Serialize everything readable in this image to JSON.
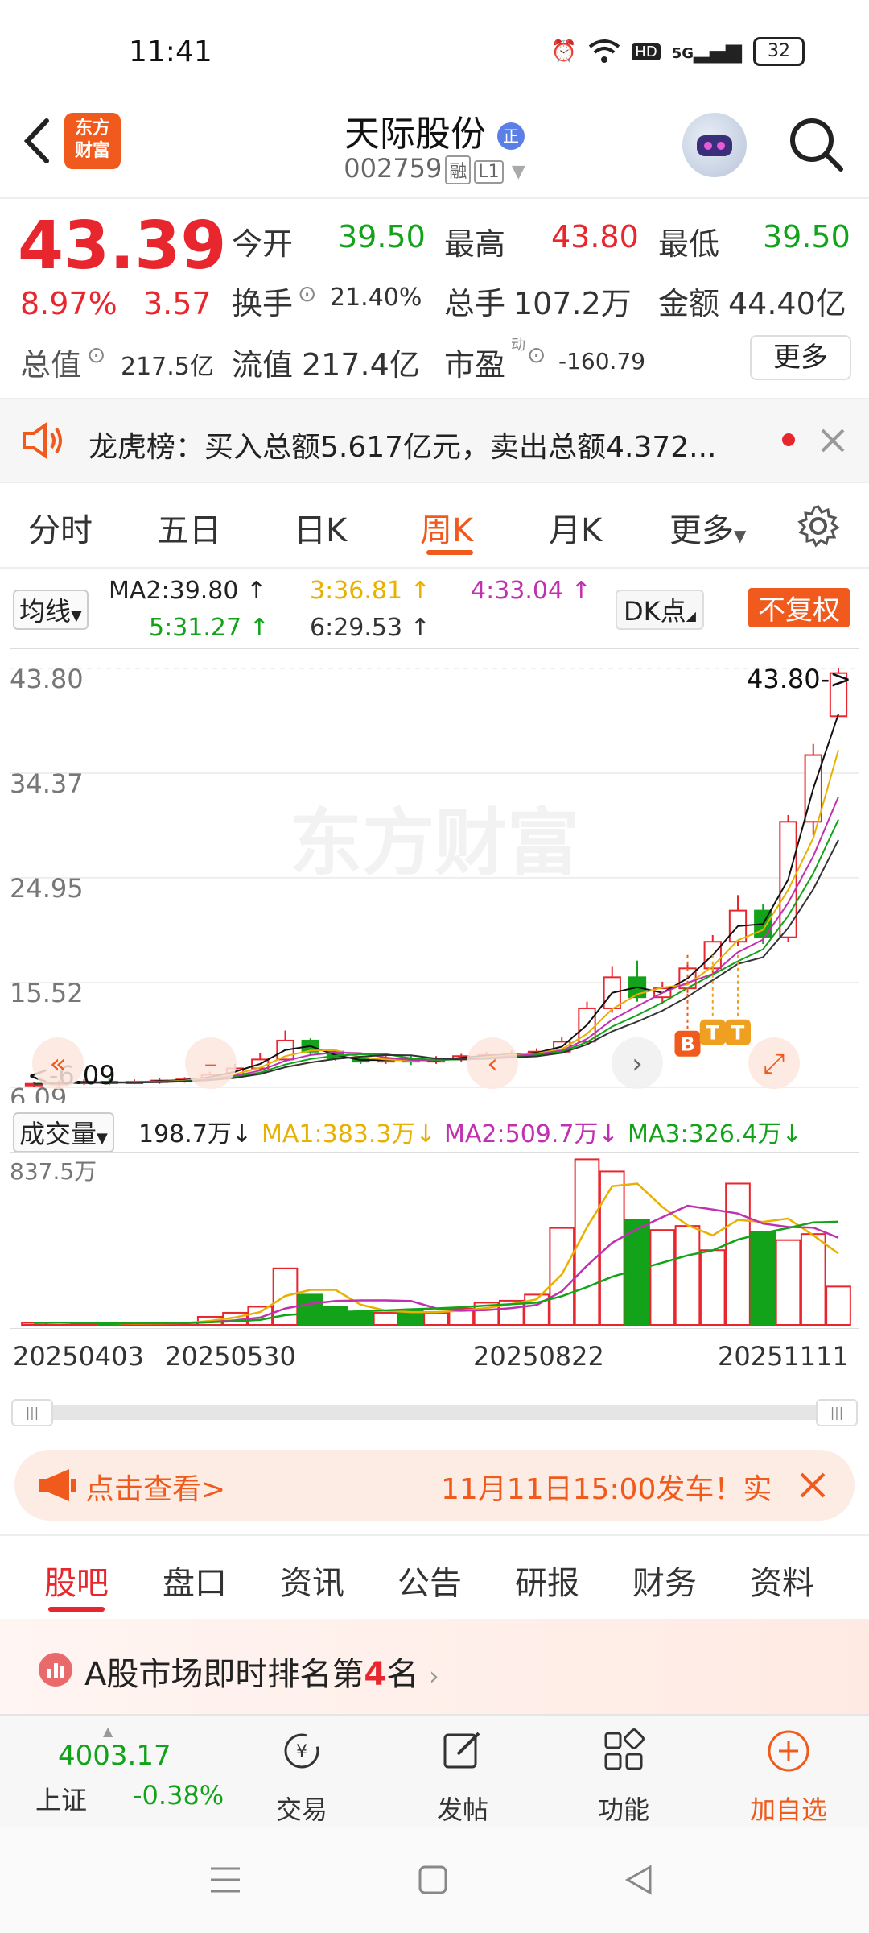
{
  "status_bar": {
    "time": "11:41",
    "battery": "32",
    "network": "5G",
    "hd": "HD"
  },
  "header": {
    "logo_line1": "东方",
    "logo_line2": "财富",
    "stock_name": "天际股份",
    "stock_code": "002759",
    "tag_margin": "融",
    "tag_level": "L1"
  },
  "quote": {
    "price": "43.39",
    "change_pct": "8.97%",
    "change": "3.57",
    "open_label": "今开",
    "open": "39.50",
    "high_label": "最高",
    "high": "43.80",
    "low_label": "最低",
    "low": "39.50",
    "turnover_label": "换手",
    "turnover": "21.40%",
    "volume_label": "总手",
    "volume": "107.2万",
    "amount_label": "金额",
    "amount": "44.40亿",
    "mktcap_label": "总值",
    "mktcap": "217.5亿",
    "float_label": "流值",
    "float": "217.4亿",
    "pe_label": "市盈",
    "pe_sup": "动",
    "pe": "-160.79",
    "more": "更多"
  },
  "news": {
    "text": "龙虎榜：买入总额5.617亿元，卖出总额4.372..."
  },
  "tabs": [
    "分时",
    "五日",
    "日K",
    "周K",
    "月K",
    "更多"
  ],
  "ma_row": {
    "ma_button": "均线",
    "ma2": "MA2:39.80",
    "ma3": "3:36.81",
    "ma4": "4:33.04",
    "ma5": "5:31.27",
    "ma6": "6:29.53",
    "dk_button": "DK点",
    "fq_button": "不复权"
  },
  "chart_data": {
    "type": "candlestick",
    "y_ticks": [
      "43.80",
      "34.37",
      "24.95",
      "15.52",
      "6.09"
    ],
    "ylim": [
      6.09,
      43.8
    ],
    "high_marker": "43.80->",
    "low_marker": "<-6.09",
    "watermark": "东方财富",
    "bt_markers": [
      "B",
      "T",
      "T"
    ],
    "candles": [
      {
        "o": 6.3,
        "c": 6.4,
        "h": 6.6,
        "l": 6.1
      },
      {
        "o": 6.4,
        "c": 6.5,
        "h": 6.7,
        "l": 6.2
      },
      {
        "o": 6.5,
        "c": 6.6,
        "h": 6.8,
        "l": 6.3
      },
      {
        "o": 6.6,
        "c": 6.5,
        "h": 6.9,
        "l": 6.3
      },
      {
        "o": 6.5,
        "c": 6.6,
        "h": 6.8,
        "l": 6.4
      },
      {
        "o": 6.6,
        "c": 6.7,
        "h": 6.9,
        "l": 6.4
      },
      {
        "o": 6.7,
        "c": 6.8,
        "h": 7.0,
        "l": 6.5
      },
      {
        "o": 6.8,
        "c": 7.2,
        "h": 7.5,
        "l": 6.7
      },
      {
        "o": 7.2,
        "c": 7.8,
        "h": 8.2,
        "l": 7.0
      },
      {
        "o": 7.8,
        "c": 8.6,
        "h": 9.2,
        "l": 7.6
      },
      {
        "o": 8.6,
        "c": 10.3,
        "h": 11.2,
        "l": 8.4
      },
      {
        "o": 10.3,
        "c": 9.3,
        "h": 10.5,
        "l": 9.0
      },
      {
        "o": 9.3,
        "c": 8.7,
        "h": 9.5,
        "l": 8.5
      },
      {
        "o": 8.7,
        "c": 8.4,
        "h": 8.9,
        "l": 8.2
      },
      {
        "o": 8.4,
        "c": 8.7,
        "h": 9.0,
        "l": 8.2
      },
      {
        "o": 8.7,
        "c": 8.4,
        "h": 8.9,
        "l": 8.1
      },
      {
        "o": 8.4,
        "c": 8.6,
        "h": 8.9,
        "l": 8.2
      },
      {
        "o": 8.6,
        "c": 8.9,
        "h": 9.1,
        "l": 8.4
      },
      {
        "o": 8.9,
        "c": 9.0,
        "h": 9.3,
        "l": 8.7
      },
      {
        "o": 9.0,
        "c": 9.1,
        "h": 9.4,
        "l": 8.8
      },
      {
        "o": 9.1,
        "c": 9.3,
        "h": 9.6,
        "l": 8.9
      },
      {
        "o": 9.3,
        "c": 10.2,
        "h": 10.6,
        "l": 9.1
      },
      {
        "o": 10.2,
        "c": 13.2,
        "h": 13.8,
        "l": 10.0
      },
      {
        "o": 13.2,
        "c": 16.0,
        "h": 17.0,
        "l": 12.8
      },
      {
        "o": 16.0,
        "c": 14.2,
        "h": 17.5,
        "l": 13.8
      },
      {
        "o": 14.2,
        "c": 15.0,
        "h": 15.6,
        "l": 13.6
      },
      {
        "o": 15.0,
        "c": 16.8,
        "h": 17.2,
        "l": 14.6
      },
      {
        "o": 16.8,
        "c": 19.2,
        "h": 19.8,
        "l": 16.4
      },
      {
        "o": 19.2,
        "c": 22.0,
        "h": 23.4,
        "l": 18.8
      },
      {
        "o": 22.0,
        "c": 19.6,
        "h": 22.6,
        "l": 19.0
      },
      {
        "o": 19.6,
        "c": 30.0,
        "h": 30.6,
        "l": 19.2
      },
      {
        "o": 30.0,
        "c": 36.0,
        "h": 37.0,
        "l": 28.8
      },
      {
        "o": 39.5,
        "c": 43.39,
        "h": 43.8,
        "l": 39.5
      }
    ]
  },
  "volume": {
    "label": "成交量",
    "value": "198.7万",
    "ma1": "MA1:383.3万",
    "ma2": "MA2:509.7万",
    "ma3": "MA3:326.4万",
    "y_max": "837.5万",
    "bars": [
      10,
      12,
      8,
      6,
      8,
      9,
      10,
      40,
      60,
      90,
      280,
      150,
      90,
      60,
      60,
      70,
      60,
      80,
      110,
      120,
      150,
      480,
      820,
      760,
      520,
      470,
      490,
      370,
      700,
      460,
      420,
      450,
      190
    ]
  },
  "dates": [
    "20250403",
    "20250530",
    "20250822",
    "20251111"
  ],
  "promo": {
    "left": "点击查看>",
    "right": "11月11日15:00发车！实"
  },
  "bottom_tabs": [
    "股吧",
    "盘口",
    "资讯",
    "公告",
    "研报",
    "财务",
    "资料"
  ],
  "rank": {
    "prefix": "A股市场即时排名第",
    "rank_num": "4",
    "suffix": "名"
  },
  "bottom_nav": {
    "index_value": "4003.17",
    "index_name": "上证",
    "index_change": "-0.38%",
    "trade": "交易",
    "post": "发帖",
    "functions": "功能",
    "add_watch": "加自选"
  },
  "colors": {
    "up": "#e8262e",
    "down": "#12a31a",
    "accent": "#f05a1c"
  }
}
